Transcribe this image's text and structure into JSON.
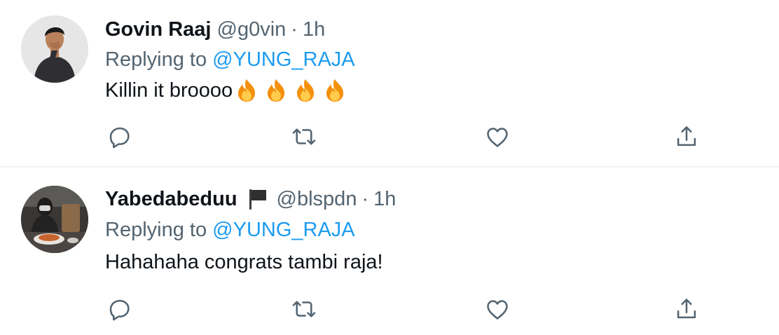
{
  "tweets": [
    {
      "display_name": "Govin Raaj",
      "handle": "@g0vin",
      "separator": "·",
      "time": "1h",
      "replying_prefix": "Replying to",
      "replying_to": "@YUNG_RAJA",
      "text": "Killin it broooo",
      "emoji": [
        "fire-icon",
        "fire-icon",
        "fire-icon",
        "fire-icon"
      ],
      "flag": null
    },
    {
      "display_name": "Yabedabeduu",
      "handle": "@blspdn",
      "separator": "·",
      "time": "1h",
      "replying_prefix": "Replying to",
      "replying_to": "@YUNG_RAJA",
      "text": "Hahahaha congrats tambi raja!",
      "emoji": [],
      "flag": "black-flag-icon"
    }
  ],
  "actions": [
    "reply-icon",
    "retweet-icon",
    "like-icon",
    "share-icon"
  ],
  "colors": {
    "link": "#1d9bf0",
    "secondary": "#536471",
    "primary_text": "#0f1419",
    "divider": "#eff3f4"
  }
}
